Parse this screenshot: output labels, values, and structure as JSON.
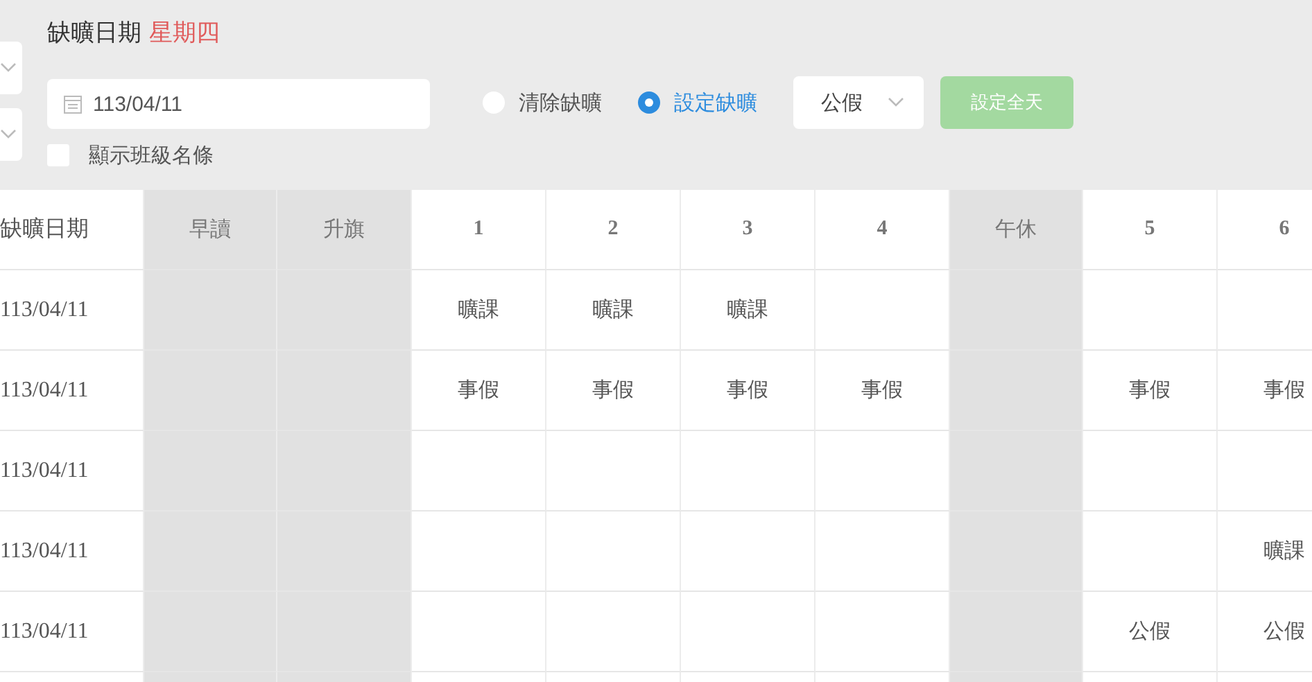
{
  "filters": {
    "title": "缺曠日期",
    "weekday": "星期四",
    "date": "113/04/11",
    "show_class_names": {
      "label": "顯示班級名條",
      "checked": false
    },
    "modes": [
      {
        "label": "清除缺曠",
        "selected": false
      },
      {
        "label": "設定缺曠",
        "selected": true
      }
    ],
    "absence_type": "公假",
    "set_all_day": {
      "label": "設定全天",
      "disabled": true
    }
  },
  "table": {
    "columns": [
      {
        "label": "缺曠日期",
        "kind": "date"
      },
      {
        "label": "早讀",
        "kind": "break"
      },
      {
        "label": "升旗",
        "kind": "break"
      },
      {
        "label": "1",
        "kind": "period"
      },
      {
        "label": "2",
        "kind": "period"
      },
      {
        "label": "3",
        "kind": "period"
      },
      {
        "label": "4",
        "kind": "period"
      },
      {
        "label": "午休",
        "kind": "break"
      },
      {
        "label": "5",
        "kind": "period"
      },
      {
        "label": "6",
        "kind": "period"
      }
    ],
    "rows": [
      {
        "cells": [
          "113/04/11",
          null,
          null,
          "曠課",
          "曠課",
          "曠課",
          null,
          null,
          null,
          null
        ]
      },
      {
        "cells": [
          "113/04/11",
          null,
          null,
          "事假",
          "事假",
          "事假",
          "事假",
          null,
          "事假",
          "事假"
        ]
      },
      {
        "cells": [
          "113/04/11",
          null,
          null,
          null,
          null,
          null,
          null,
          null,
          null,
          null
        ]
      },
      {
        "cells": [
          "113/04/11",
          null,
          null,
          null,
          null,
          null,
          null,
          null,
          null,
          "曠課"
        ]
      },
      {
        "cells": [
          "113/04/11",
          null,
          null,
          null,
          null,
          null,
          null,
          null,
          "公假",
          "公假"
        ]
      }
    ]
  }
}
